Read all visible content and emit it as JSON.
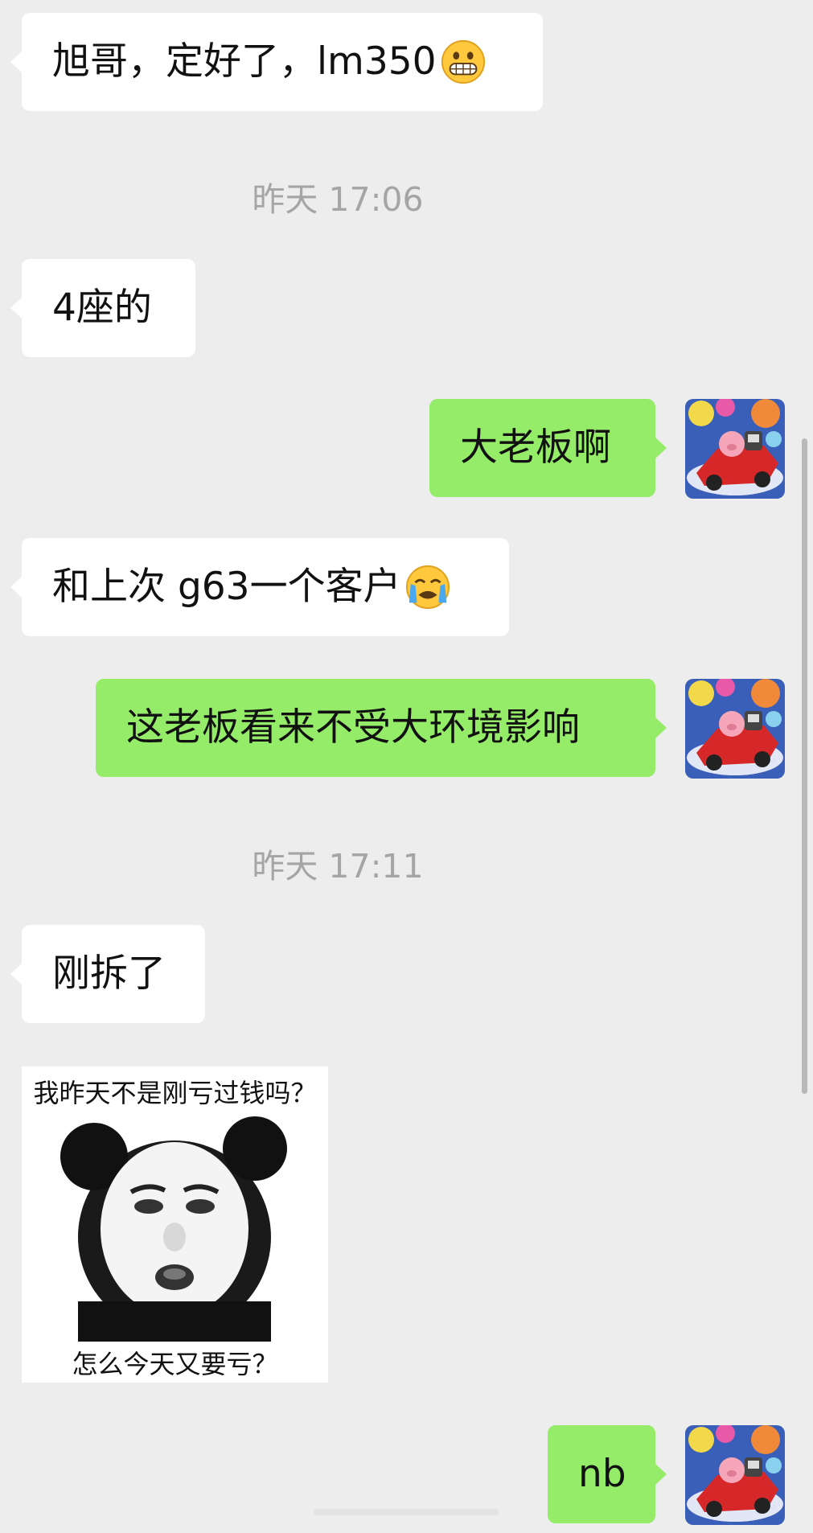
{
  "messages": [
    {
      "side": "left",
      "text": "旭哥，定好了，lm350",
      "emoji": "grinning-face-emoji"
    },
    {
      "side": "left",
      "text": "4座的"
    },
    {
      "side": "right",
      "text": "大老板啊"
    },
    {
      "side": "left",
      "text": "和上次 g63一个客户",
      "emoji": "loudly-crying-face-emoji"
    },
    {
      "side": "right",
      "text": "这老板看来不受大环境影响"
    },
    {
      "side": "left",
      "text": "刚拆了"
    },
    {
      "side": "left",
      "type": "sticker",
      "top_text": "我昨天不是刚亏过钱吗？",
      "bottom_text": "怎么今天又要亏？"
    },
    {
      "side": "right",
      "text": "nb"
    }
  ],
  "timestamps": [
    "昨天 17:06",
    "昨天 17:11"
  ],
  "avatar": {
    "icon": "pig-race-car-avatar"
  },
  "colors": {
    "background": "#ededed",
    "incoming_bubble": "#ffffff",
    "outgoing_bubble": "#95ec69",
    "timestamp_text": "#a5a5a5"
  }
}
